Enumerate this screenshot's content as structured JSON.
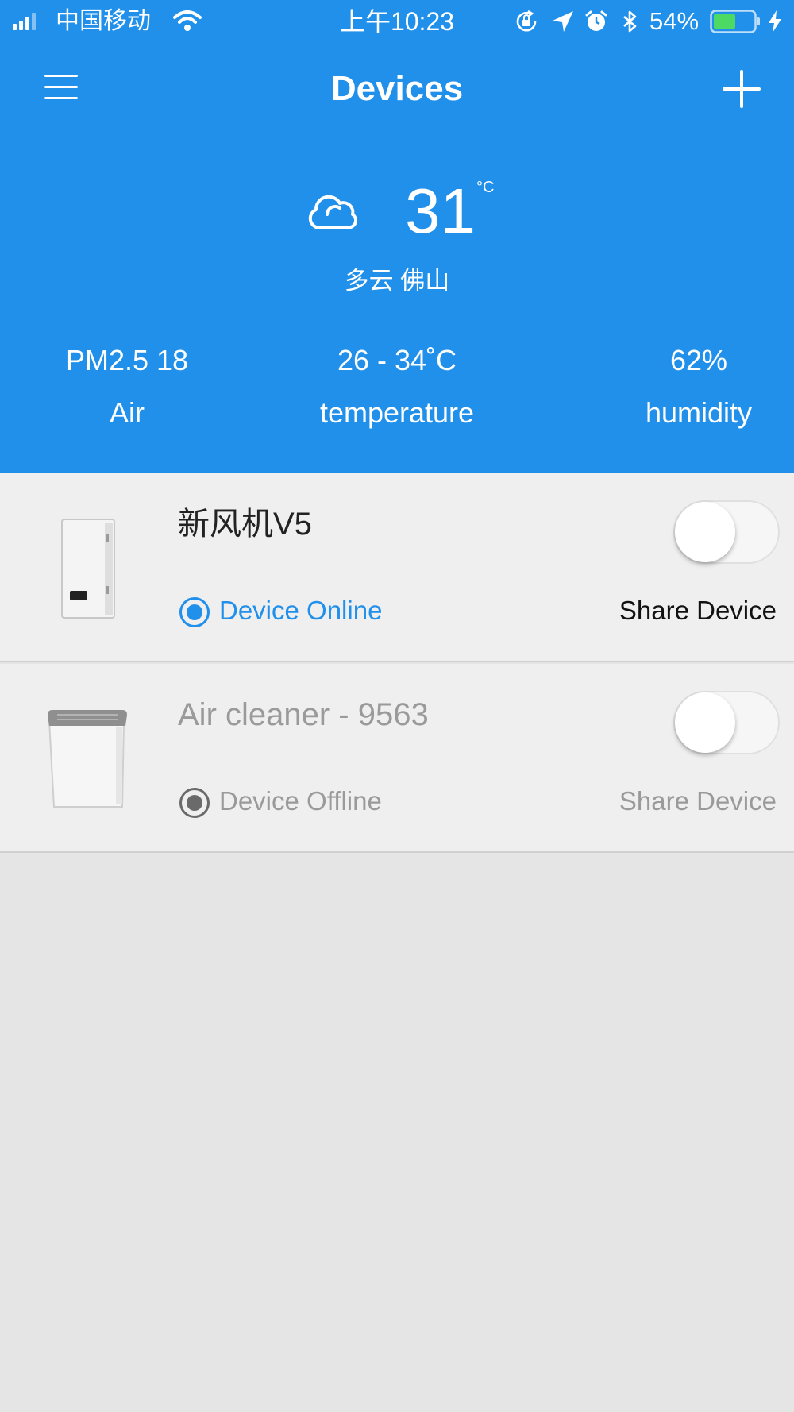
{
  "status_bar": {
    "carrier": "中国移动",
    "time": "上午10:23",
    "battery_percent": "54%",
    "battery_level": 0.54,
    "icons": [
      "signal-icon",
      "wifi-icon",
      "orientation-lock-icon",
      "location-icon",
      "alarm-icon",
      "bluetooth-icon",
      "battery-icon",
      "charging-icon"
    ]
  },
  "nav": {
    "title": "Devices",
    "left_icon": "menu-icon",
    "right_icon": "plus-icon"
  },
  "weather": {
    "icon": "cloud-icon",
    "temperature": "31",
    "unit": "°C",
    "condition_city": "多云  佛山",
    "stats": [
      {
        "value": "PM2.5 18",
        "label": "Air"
      },
      {
        "value": "26 - 34˚C",
        "label": "temperature"
      },
      {
        "value": "62%",
        "label": "humidity"
      }
    ]
  },
  "devices": [
    {
      "name": "新风机V5",
      "status": "Device Online",
      "share_label": "Share Device",
      "power_on": false,
      "online": true
    },
    {
      "name": "Air cleaner - 9563",
      "status": "Device Offline",
      "share_label": "Share Device",
      "power_on": false,
      "online": false
    }
  ],
  "colors": {
    "header_bg": "#2190ea",
    "accent": "#2190ea",
    "page_bg": "#e5e5e5",
    "card_bg": "#efefef",
    "offline_text": "#9a9a9a"
  }
}
